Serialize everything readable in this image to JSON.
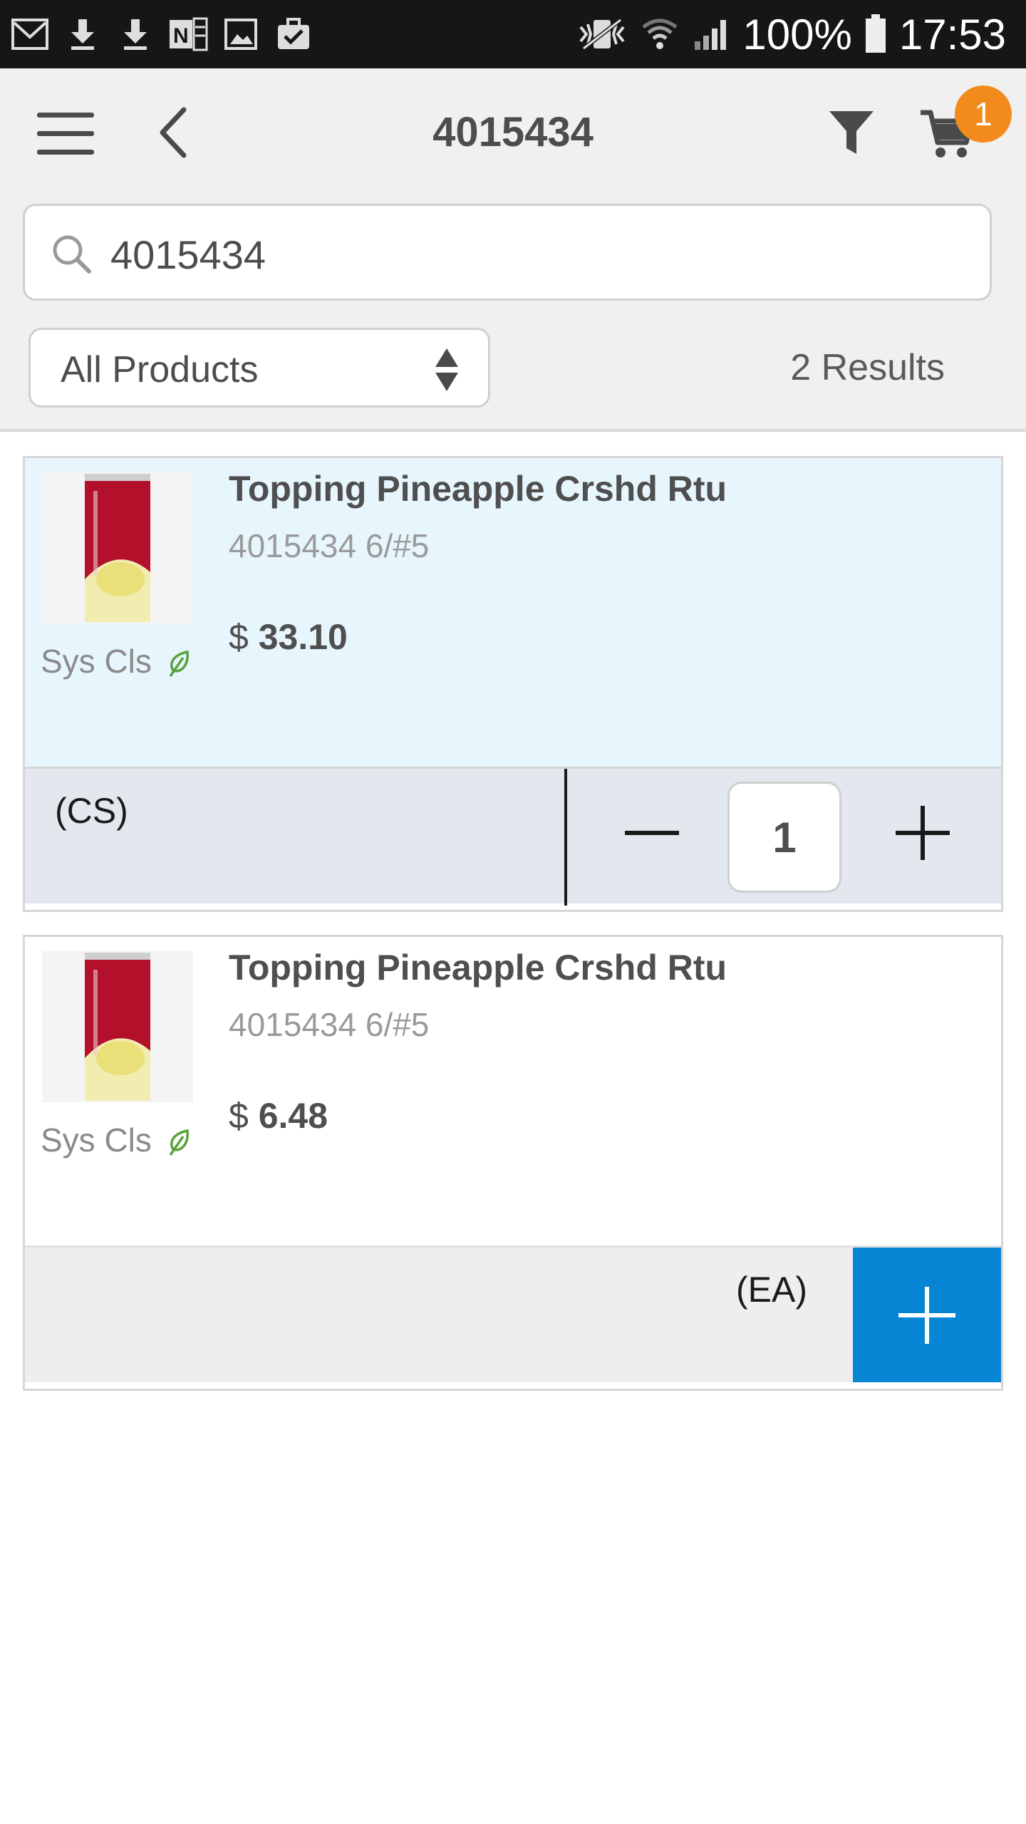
{
  "status_bar": {
    "battery_percent": "100%",
    "time": "17:53",
    "left_icons": [
      "gmail-icon",
      "download-icon",
      "download-icon",
      "onenote-icon",
      "image-icon",
      "clipboard-check-icon"
    ],
    "right_icons": [
      "vibrate-icon",
      "wifi-icon",
      "signal-icon",
      "battery-icon"
    ]
  },
  "header": {
    "title": "4015434",
    "cart_badge": "1"
  },
  "search": {
    "value": "4015434",
    "placeholder": ""
  },
  "filter": {
    "selected": "All Products",
    "results_text": "2 Results"
  },
  "products": [
    {
      "name": "Topping Pineapple Crshd Rtu",
      "code": "4015434 6/#5",
      "brand": "Sys Cls",
      "currency": "$",
      "price": "33.10",
      "uom": "(CS)",
      "quantity": "1"
    },
    {
      "name": "Topping Pineapple Crshd Rtu",
      "code": "4015434 6/#5",
      "brand": "Sys Cls",
      "currency": "$",
      "price": "6.48",
      "uom": "(EA)"
    }
  ],
  "colors": {
    "accent": "#0585d4",
    "badge": "#f28a1c",
    "selected_card_bg": "#e7f5fd",
    "leaf": "#5aa13c"
  }
}
